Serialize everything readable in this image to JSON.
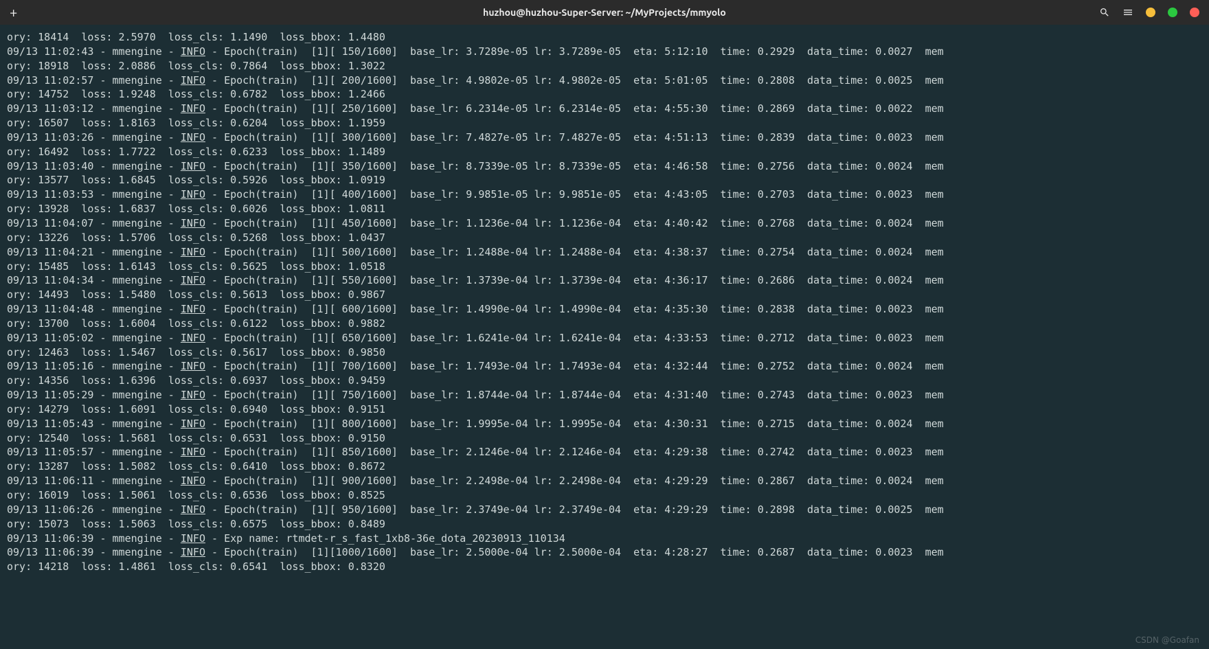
{
  "window": {
    "title": "huzhou@huzhou-Super-Server: ~/MyProjects/mmyolo",
    "new_tab_tooltip": "New Tab",
    "search_tooltip": "Search",
    "settings_tooltip": "Settings"
  },
  "watermark": "CSDN @Goafan",
  "log": {
    "first_partial": "ory: 18414  loss: 2.5970  loss_cls: 1.1490  loss_bbox: 1.4480",
    "entries": [
      {
        "ts": "09/13 11:02:43",
        "step": " 150",
        "base_lr": "3.7289e-05",
        "lr": "3.7289e-05",
        "eta": "5:12:10",
        "time": "0.2929",
        "data_time": "0.0027",
        "second": "ory: 18918  loss: 2.0886  loss_cls: 0.7864  loss_bbox: 1.3022"
      },
      {
        "ts": "09/13 11:02:57",
        "step": " 200",
        "base_lr": "4.9802e-05",
        "lr": "4.9802e-05",
        "eta": "5:01:05",
        "time": "0.2808",
        "data_time": "0.0025",
        "second": "ory: 14752  loss: 1.9248  loss_cls: 0.6782  loss_bbox: 1.2466"
      },
      {
        "ts": "09/13 11:03:12",
        "step": " 250",
        "base_lr": "6.2314e-05",
        "lr": "6.2314e-05",
        "eta": "4:55:30",
        "time": "0.2869",
        "data_time": "0.0022",
        "second": "ory: 16507  loss: 1.8163  loss_cls: 0.6204  loss_bbox: 1.1959"
      },
      {
        "ts": "09/13 11:03:26",
        "step": " 300",
        "base_lr": "7.4827e-05",
        "lr": "7.4827e-05",
        "eta": "4:51:13",
        "time": "0.2839",
        "data_time": "0.0023",
        "second": "ory: 16492  loss: 1.7722  loss_cls: 0.6233  loss_bbox: 1.1489"
      },
      {
        "ts": "09/13 11:03:40",
        "step": " 350",
        "base_lr": "8.7339e-05",
        "lr": "8.7339e-05",
        "eta": "4:46:58",
        "time": "0.2756",
        "data_time": "0.0024",
        "second": "ory: 13577  loss: 1.6845  loss_cls: 0.5926  loss_bbox: 1.0919"
      },
      {
        "ts": "09/13 11:03:53",
        "step": " 400",
        "base_lr": "9.9851e-05",
        "lr": "9.9851e-05",
        "eta": "4:43:05",
        "time": "0.2703",
        "data_time": "0.0023",
        "second": "ory: 13928  loss: 1.6837  loss_cls: 0.6026  loss_bbox: 1.0811"
      },
      {
        "ts": "09/13 11:04:07",
        "step": " 450",
        "base_lr": "1.1236e-04",
        "lr": "1.1236e-04",
        "eta": "4:40:42",
        "time": "0.2768",
        "data_time": "0.0024",
        "second": "ory: 13226  loss: 1.5706  loss_cls: 0.5268  loss_bbox: 1.0437"
      },
      {
        "ts": "09/13 11:04:21",
        "step": " 500",
        "base_lr": "1.2488e-04",
        "lr": "1.2488e-04",
        "eta": "4:38:37",
        "time": "0.2754",
        "data_time": "0.0024",
        "second": "ory: 15485  loss: 1.6143  loss_cls: 0.5625  loss_bbox: 1.0518"
      },
      {
        "ts": "09/13 11:04:34",
        "step": " 550",
        "base_lr": "1.3739e-04",
        "lr": "1.3739e-04",
        "eta": "4:36:17",
        "time": "0.2686",
        "data_time": "0.0024",
        "second": "ory: 14493  loss: 1.5480  loss_cls: 0.5613  loss_bbox: 0.9867"
      },
      {
        "ts": "09/13 11:04:48",
        "step": " 600",
        "base_lr": "1.4990e-04",
        "lr": "1.4990e-04",
        "eta": "4:35:30",
        "time": "0.2838",
        "data_time": "0.0023",
        "second": "ory: 13700  loss: 1.6004  loss_cls: 0.6122  loss_bbox: 0.9882"
      },
      {
        "ts": "09/13 11:05:02",
        "step": " 650",
        "base_lr": "1.6241e-04",
        "lr": "1.6241e-04",
        "eta": "4:33:53",
        "time": "0.2712",
        "data_time": "0.0023",
        "second": "ory: 12463  loss: 1.5467  loss_cls: 0.5617  loss_bbox: 0.9850"
      },
      {
        "ts": "09/13 11:05:16",
        "step": " 700",
        "base_lr": "1.7493e-04",
        "lr": "1.7493e-04",
        "eta": "4:32:44",
        "time": "0.2752",
        "data_time": "0.0024",
        "second": "ory: 14356  loss: 1.6396  loss_cls: 0.6937  loss_bbox: 0.9459"
      },
      {
        "ts": "09/13 11:05:29",
        "step": " 750",
        "base_lr": "1.8744e-04",
        "lr": "1.8744e-04",
        "eta": "4:31:40",
        "time": "0.2743",
        "data_time": "0.0023",
        "second": "ory: 14279  loss: 1.6091  loss_cls: 0.6940  loss_bbox: 0.9151"
      },
      {
        "ts": "09/13 11:05:43",
        "step": " 800",
        "base_lr": "1.9995e-04",
        "lr": "1.9995e-04",
        "eta": "4:30:31",
        "time": "0.2715",
        "data_time": "0.0024",
        "second": "ory: 12540  loss: 1.5681  loss_cls: 0.6531  loss_bbox: 0.9150"
      },
      {
        "ts": "09/13 11:05:57",
        "step": " 850",
        "base_lr": "2.1246e-04",
        "lr": "2.1246e-04",
        "eta": "4:29:38",
        "time": "0.2742",
        "data_time": "0.0023",
        "second": "ory: 13287  loss: 1.5082  loss_cls: 0.6410  loss_bbox: 0.8672"
      },
      {
        "ts": "09/13 11:06:11",
        "step": " 900",
        "base_lr": "2.2498e-04",
        "lr": "2.2498e-04",
        "eta": "4:29:29",
        "time": "0.2867",
        "data_time": "0.0024",
        "second": "ory: 16019  loss: 1.5061  loss_cls: 0.6536  loss_bbox: 0.8525"
      },
      {
        "ts": "09/13 11:06:26",
        "step": " 950",
        "base_lr": "2.3749e-04",
        "lr": "2.3749e-04",
        "eta": "4:29:29",
        "time": "0.2898",
        "data_time": "0.0025",
        "second": "ory: 15073  loss: 1.5063  loss_cls: 0.6575  loss_bbox: 0.8489"
      }
    ],
    "exp_line": {
      "ts": "09/13 11:06:39",
      "text": "Exp name: rtmdet-r_s_fast_1xb8-36e_dota_20230913_110134"
    },
    "last_entry": {
      "ts": "09/13 11:06:39",
      "step": "1000",
      "base_lr": "2.5000e-04",
      "lr": "2.5000e-04",
      "eta": "4:28:27",
      "time": "0.2687",
      "data_time": "0.0023",
      "second": "ory: 14218  loss: 1.4861  loss_cls: 0.6541  loss_bbox: 0.8320"
    },
    "total_steps": "1600",
    "epoch": "1",
    "level": "INFO",
    "source": "mmengine",
    "phase": "Epoch(train)"
  }
}
